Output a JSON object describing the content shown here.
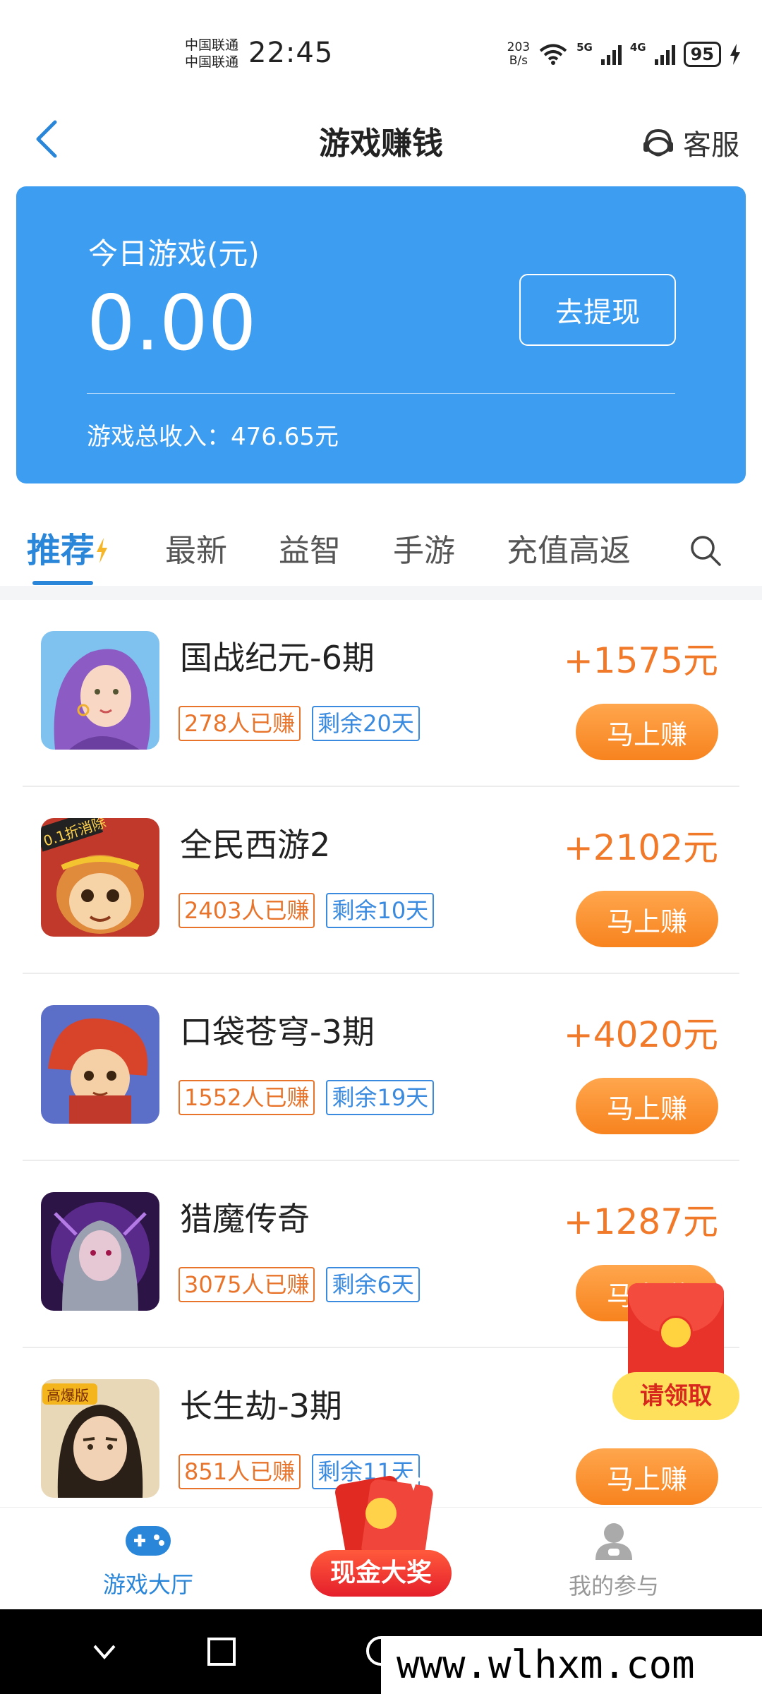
{
  "status": {
    "carrier1": "中国联通",
    "carrier2": "中国联通",
    "time": "22:45",
    "net_speed_value": "203",
    "net_speed_unit": "B/s",
    "gen1": "5G",
    "gen2": "4G",
    "battery": "95"
  },
  "header": {
    "title": "游戏赚钱",
    "service_label": "客服"
  },
  "card": {
    "label": "今日游戏(元)",
    "amount": "0.00",
    "withdraw_label": "去提现",
    "total_label": "游戏总收入：476.65元"
  },
  "tabs": [
    {
      "label": "推荐",
      "active": true
    },
    {
      "label": "最新"
    },
    {
      "label": "益智"
    },
    {
      "label": "手游"
    },
    {
      "label": "充值高返"
    }
  ],
  "games": [
    {
      "name": "国战纪元-6期",
      "earned": "278人已赚",
      "remaining": "剩余20天",
      "reward": "+1575元",
      "button": "马上赚"
    },
    {
      "name": "全民西游2",
      "earned": "2403人已赚",
      "remaining": "剩余10天",
      "reward": "+2102元",
      "button": "马上赚",
      "thumb_text": "0.1折消除"
    },
    {
      "name": "口袋苍穹-3期",
      "earned": "1552人已赚",
      "remaining": "剩余19天",
      "reward": "+4020元",
      "button": "马上赚"
    },
    {
      "name": "猎魔传奇",
      "earned": "3075人已赚",
      "remaining": "剩余6天",
      "reward": "+1287元",
      "button": "马上赚"
    },
    {
      "name": "长生劫-3期",
      "earned": "851人已赚",
      "remaining": "剩余11天",
      "reward": "+2",
      "button": "马上赚",
      "thumb_text": "高爆版"
    }
  ],
  "red_packet": {
    "label": "请领取"
  },
  "bottom_nav": {
    "hall": "游戏大厅",
    "cash_prize": "现金大奖",
    "mine": "我的参与"
  },
  "watermark": "www.wlhxm.com",
  "colors": {
    "accent": "#3d9df0",
    "reward": "#f07a2a",
    "button": "#f7831e",
    "tag_orange": "#e8742b",
    "tag_blue": "#3a8be0"
  }
}
